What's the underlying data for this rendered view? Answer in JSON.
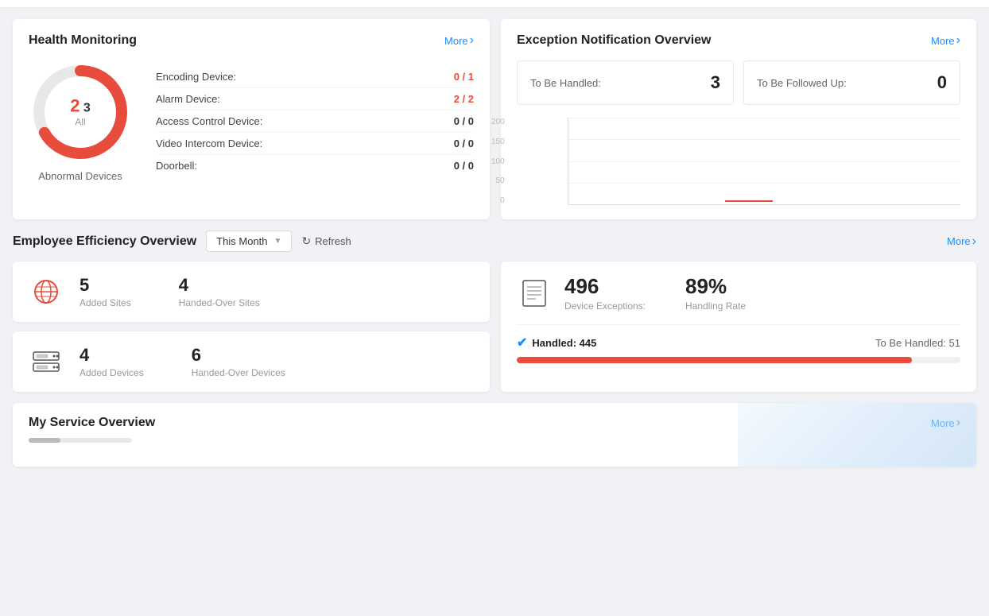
{
  "health": {
    "title": "Health Monitoring",
    "more": "More",
    "donut": {
      "abnormal": "2",
      "total": "3",
      "all_label": "All"
    },
    "label": "Abnormal Devices",
    "devices": [
      {
        "name": "Encoding Device:",
        "value": "0 / 1",
        "red": true
      },
      {
        "name": "Alarm Device:",
        "value": "2 / 2",
        "red": true
      },
      {
        "name": "Access Control Device:",
        "value": "0 / 0",
        "red": false
      },
      {
        "name": "Video Intercom Device:",
        "value": "0 / 0",
        "red": false
      },
      {
        "name": "Doorbell:",
        "value": "0 / 0",
        "red": false
      }
    ]
  },
  "exception": {
    "title": "Exception Notification Overview",
    "more": "More",
    "to_be_handled_label": "To Be Handled:",
    "to_be_handled_value": "3",
    "to_be_followed_label": "To Be Followed Up:",
    "to_be_followed_value": "0",
    "chart_y_labels": [
      "200",
      "150",
      "100",
      "50",
      "0"
    ]
  },
  "employee": {
    "title": "Employee Efficiency Overview",
    "period": "This Month",
    "refresh": "Refresh",
    "more": "More",
    "sites": {
      "added_num": "5",
      "added_label": "Added Sites",
      "handedover_num": "4",
      "handedover_label": "Handed-Over Sites"
    },
    "devices": {
      "added_num": "4",
      "added_label": "Added Devices",
      "handedover_num": "6",
      "handedover_label": "Handed-Over Devices"
    },
    "exceptions": {
      "device_num": "496",
      "device_label": "Device Exceptions:",
      "rate_num": "89%",
      "rate_label": "Handling Rate",
      "handled_label": "Handled: 445",
      "to_be_label": "To Be Handled: 51",
      "progress_pct": 89
    }
  },
  "service": {
    "title": "My Service Overview",
    "more": "More"
  }
}
